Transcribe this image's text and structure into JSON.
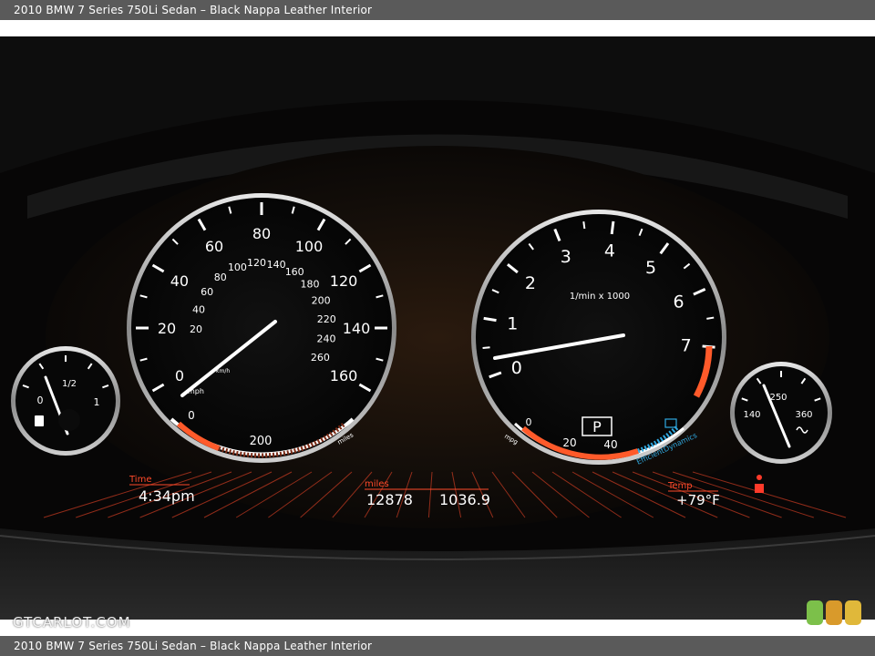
{
  "caption": {
    "top": "2010 BMW 7 Series 750Li Sedan – Black Nappa Leather Interior",
    "bottom": "2010 BMW 7 Series 750Li Sedan – Black Nappa Leather Interior"
  },
  "watermark": "GTCARLOT.COM",
  "rating_colors": [
    "#7cc04a",
    "#d99a2b",
    "#e0b83a"
  ],
  "speedometer": {
    "mph_labels": [
      "0",
      "20",
      "40",
      "60",
      "80",
      "100",
      "120",
      "140",
      "160"
    ],
    "unit_mph": "mph",
    "kmh_labels": [
      "20",
      "40",
      "60",
      "80",
      "100",
      "120",
      "140",
      "160",
      "180",
      "200",
      "220",
      "240",
      "260"
    ],
    "unit_kmh": "km/h",
    "range_scale": [
      "0",
      "200"
    ],
    "range_unit": "miles",
    "needle_mph": 0
  },
  "tachometer": {
    "labels": [
      "0",
      "1",
      "2",
      "3",
      "4",
      "5",
      "6",
      "7"
    ],
    "unit": "1/min x 1000",
    "needle_rpm": 0.8,
    "gear": "P",
    "mpg_unit": "mpg",
    "mpg_labels": [
      "0",
      "20",
      "40"
    ],
    "efficient_dynamics": "EfficientDynamics"
  },
  "fuel_gauge": {
    "labels": [
      "0",
      "1/2",
      "1"
    ],
    "level": 0.1
  },
  "oil_gauge": {
    "labels": [
      "140",
      "250",
      "360"
    ]
  },
  "display": {
    "time_label": "Time",
    "time_value": "4:34pm",
    "miles_label": "miles",
    "odometer": "12878",
    "trip": "1036.9",
    "temp_label": "Temp",
    "temp_value": "+79°F"
  },
  "colors": {
    "accent_orange": "#ff5a2a",
    "display_red": "#ff4a2a",
    "efficient_blue": "#2fa8e0"
  }
}
